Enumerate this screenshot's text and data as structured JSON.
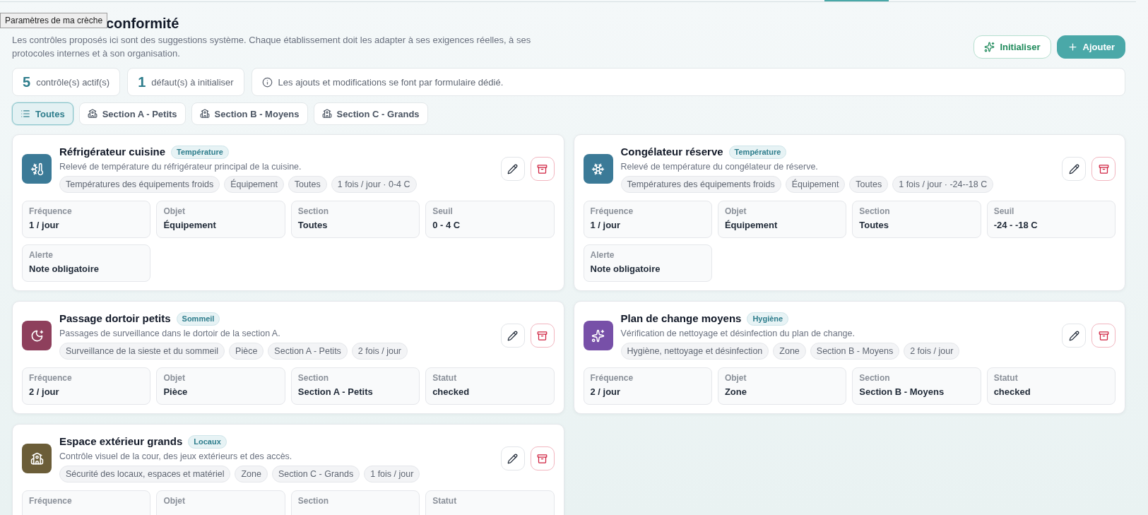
{
  "tooltip": {
    "text": "Paramètres de ma crèche"
  },
  "header": {
    "title": "conformité",
    "subtitle": "Les contrôles proposés ici sont des suggestions système. Chaque établissement doit les adapter à ses exigences réelles, à ses protocoles internes et à son organisation.",
    "buttons": [
      {
        "kind": "initialize",
        "label": "Initialiser"
      },
      {
        "kind": "add",
        "label": "Ajouter"
      }
    ]
  },
  "stats": [
    {
      "value": "5",
      "label": "contrôle(s) actif(s)"
    },
    {
      "value": "1",
      "label": "défaut(s) à initialiser"
    }
  ],
  "notice": "Les ajouts et modifications se font par formulaire dédié.",
  "filters": [
    {
      "kind": "all",
      "label": "Toutes",
      "selected": true
    },
    {
      "kind": "section",
      "label": "Section A - Petits",
      "selected": false
    },
    {
      "kind": "section",
      "label": "Section B - Moyens",
      "selected": false
    },
    {
      "kind": "section",
      "label": "Section C - Grands",
      "selected": false
    }
  ],
  "controls": [
    {
      "kind": "fridge",
      "color": "#3b7a97",
      "title": "Réfrigérateur cuisine",
      "category": "Température",
      "description": "Relevé de température du réfrigérateur principal de la cuisine.",
      "tags": [
        "Températures des équipements froids",
        "Équipement",
        "Toutes",
        "1 fois / jour · 0-4 C"
      ],
      "fields": [
        {
          "label": "Fréquence",
          "value": "1 / jour"
        },
        {
          "label": "Objet",
          "value": "Équipement"
        },
        {
          "label": "Section",
          "value": "Toutes"
        },
        {
          "label": "Seuil",
          "value": "0 - 4 C"
        },
        {
          "label": "Alerte",
          "value": "Note obligatoire"
        }
      ]
    },
    {
      "kind": "freezer",
      "color": "#3b7a97",
      "title": "Congélateur réserve",
      "category": "Température",
      "description": "Relevé de température du congélateur de réserve.",
      "tags": [
        "Températures des équipements froids",
        "Équipement",
        "Toutes",
        "1 fois / jour · -24--18 C"
      ],
      "fields": [
        {
          "label": "Fréquence",
          "value": "1 / jour"
        },
        {
          "label": "Objet",
          "value": "Équipement"
        },
        {
          "label": "Section",
          "value": "Toutes"
        },
        {
          "label": "Seuil",
          "value": "-24 - -18 C"
        },
        {
          "label": "Alerte",
          "value": "Note obligatoire"
        }
      ]
    },
    {
      "kind": "sleep",
      "color": "#8e3f5c",
      "title": "Passage dortoir petits",
      "category": "Sommeil",
      "description": "Passages de surveillance dans le dortoir de la section A.",
      "tags": [
        "Surveillance de la sieste et du sommeil",
        "Pièce",
        "Section A - Petits",
        "2 fois / jour"
      ],
      "fields": [
        {
          "label": "Fréquence",
          "value": "2 / jour"
        },
        {
          "label": "Objet",
          "value": "Pièce"
        },
        {
          "label": "Section",
          "value": "Section A - Petits"
        },
        {
          "label": "Statut",
          "value": "checked"
        }
      ]
    },
    {
      "kind": "hygiene",
      "color": "#7750a8",
      "title": "Plan de change moyens",
      "category": "Hygiène",
      "description": "Vérification de nettoyage et désinfection du plan de change.",
      "tags": [
        "Hygiène, nettoyage et désinfection",
        "Zone",
        "Section B - Moyens",
        "2 fois / jour"
      ],
      "fields": [
        {
          "label": "Fréquence",
          "value": "2 / jour"
        },
        {
          "label": "Objet",
          "value": "Zone"
        },
        {
          "label": "Section",
          "value": "Section B - Moyens"
        },
        {
          "label": "Statut",
          "value": "checked"
        }
      ]
    },
    {
      "kind": "premises",
      "color": "#6b5d38",
      "title": "Espace extérieur grands",
      "category": "Locaux",
      "description": "Contrôle visuel de la cour, des jeux extérieurs et des accès.",
      "tags": [
        "Sécurité des locaux, espaces et matériel",
        "Zone",
        "Section C - Grands",
        "1 fois / jour"
      ],
      "fields": [
        {
          "label": "Fréquence"
        },
        {
          "label": "Objet"
        },
        {
          "label": "Section"
        },
        {
          "label": "Statut"
        }
      ]
    }
  ]
}
